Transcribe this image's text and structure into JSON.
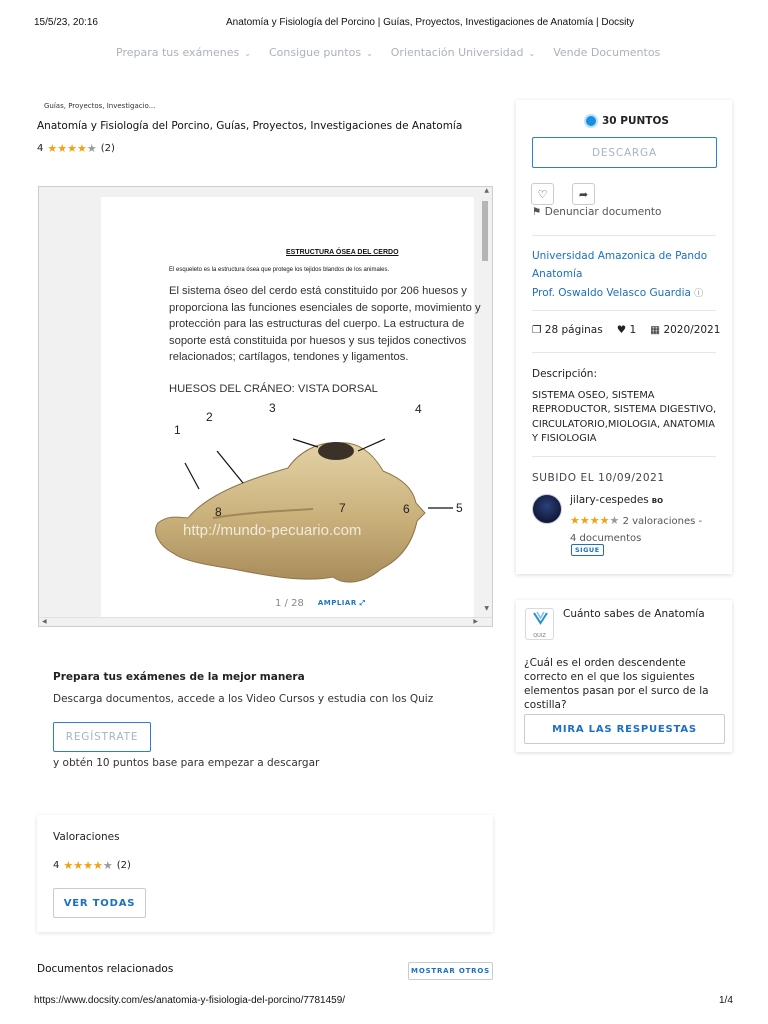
{
  "print_header": {
    "datetime": "15/5/23, 20:16",
    "title": "Anatomía y Fisiología del Porcino | Guías, Proyectos, Investigaciones de Anatomía | Docsity"
  },
  "nav": {
    "items": [
      {
        "label": "Prepara tus exámenes"
      },
      {
        "label": "Consigue puntos"
      },
      {
        "label": "Orientación Universidad"
      },
      {
        "label": "Vende Documentos"
      }
    ]
  },
  "breadcrumb": "Guías, Proyectos, Investigacio...",
  "document": {
    "title": "Anatomía y Fisiología del Porcino, Guías, Proyectos, Investigaciones de Anatomía",
    "rating_value": "4",
    "rating_stars": 4,
    "rating_count": "(2)"
  },
  "viewer": {
    "page_heading": "ESTRUCTURA ÓSEA DEL CERDO",
    "page_intro": "El esqueleto es la estructura ósea que protege los tejidos blandos de los animales.",
    "page_body": "El sistema óseo del cerdo está constituido por 206 huesos y proporciona las funciones esenciales de soporte, movimiento y protección para las estructuras del cuerpo. La estructura de soporte está constituida por huesos y sus tejidos conectivos relacionados; cartílagos, tendones y ligamentos.",
    "page_subheading": "HUESOS DEL CRÁNEO: VISTA DORSAL",
    "image_watermark": "http://mundo-pecuario.com",
    "callouts": [
      "1",
      "2",
      "3",
      "4",
      "5",
      "6",
      "7",
      "8"
    ],
    "pager": "1 / 28",
    "zoom_label": "AMPLIAR"
  },
  "sidebar": {
    "points": "30 PUNTOS",
    "download_label": "DESCARGA",
    "report_label": "Denunciar documento",
    "university": "Universidad Amazonica de Pando",
    "subject": "Anatomía",
    "professor": "Prof. Oswaldo Velasco Guardia",
    "pages": "28 páginas",
    "likes": "1",
    "year": "2020/2021",
    "description_label": "Descripción:",
    "description": "SISTEMA OSEO, SISTEMA REPRODUCTOR, SISTEMA DIGESTIVO, CIRCULATORIO,MIOLOGIA, ANATOMIA Y FISIOLOGIA",
    "uploaded": "SUBIDO EL 10/09/2021",
    "uploader_name": "jilary-cespedes",
    "uploader_country": "BO",
    "uploader_stars": 4,
    "uploader_reviews": "2 valoraciones -",
    "uploader_docs": "4 documentos",
    "follow_label": "SIGUE"
  },
  "quiz": {
    "icon_label": "QUIZ",
    "title": "Cuánto sabes de Anatomía",
    "question": "¿Cuál es el orden descendente correcto en el que los siguientes elementos pasan por el surco de la costilla?",
    "button_label": "MIRA LAS RESPUESTAS"
  },
  "promo": {
    "title": "Prepara tus exámenes de la mejor manera",
    "text": "Descarga documentos, accede a los Video Cursos y estudia con los Quiz",
    "button_label": "REGÍSTRATE",
    "subtext": "y obtén 10 puntos base para empezar a descargar"
  },
  "ratings": {
    "title": "Valoraciones",
    "value": "4",
    "stars": 4,
    "count": "(2)",
    "button_label": "VER TODAS"
  },
  "related": {
    "title": "Documentos relacionados",
    "button_label": "MOSTRAR OTROS"
  },
  "print_footer": {
    "url": "https://www.docsity.com/es/anatomia-y-fisiologia-del-porcino/7781459/",
    "page": "1/4"
  },
  "colors": {
    "accent": "#1b6fc4",
    "star": "#f3a20f",
    "nav_text": "#aab2bd"
  }
}
